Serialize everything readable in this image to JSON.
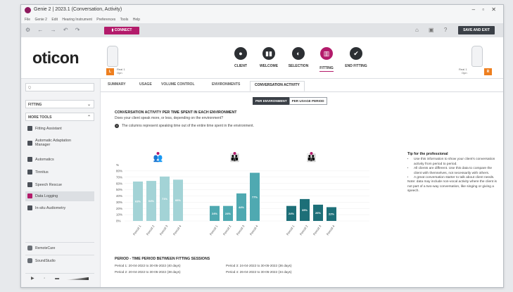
{
  "window": {
    "title": "Genie 2 | 2023.1 (Conversation, Activity)",
    "controls": "– ▫ ✕"
  },
  "menu": [
    "File",
    "Genie 2",
    "Edit",
    "Hearing Instrument",
    "Preferences",
    "Tools",
    "Help"
  ],
  "toolbar": {
    "connect_label": "CONNECT",
    "save_exit_label": "SAVE AND EXIT"
  },
  "header": {
    "logo": "oticon",
    "left_ear_badge": "L",
    "left_ear_label_1": "Real 1",
    "left_ear_label_2": "Opn",
    "right_ear_badge": "R",
    "right_ear_label_1": "Real 1",
    "right_ear_label_2": "Opn",
    "steps": [
      {
        "label": "CLIENT",
        "icon": "person-icon",
        "glyph": "●"
      },
      {
        "label": "WELCOME",
        "icon": "hearing-aids-icon",
        "glyph": "▮▮"
      },
      {
        "label": "SELECTION",
        "icon": "selection-icon",
        "glyph": "◐"
      },
      {
        "label": "FITTING",
        "icon": "fitting-icon",
        "glyph": "▥"
      },
      {
        "label": "END FITTING",
        "icon": "check-icon",
        "glyph": "✔"
      }
    ]
  },
  "sidebar": {
    "search_placeholder": "Q",
    "section_dropdown": "FITTING",
    "more_tools_dropdown": "MORE TOOLS",
    "items": [
      {
        "label": "Fitting Assistant"
      },
      {
        "label": "Automatic Adaptation"
      },
      {
        "label": "Manager"
      },
      {
        "label": "Automatics"
      },
      {
        "label": "Tinnitus"
      },
      {
        "label": "Speech Rescue"
      },
      {
        "label": "Data Logging"
      },
      {
        "label": "In-situ Audiometry"
      }
    ],
    "bottom": [
      {
        "label": "RemoteCare"
      },
      {
        "label": "SoundStudio"
      }
    ]
  },
  "tabs": [
    "SUMMARY",
    "USAGE",
    "VOLUME CONTROL",
    "ENVIRONMENTS",
    "CONVERSATION ACTIVITY"
  ],
  "toggle": {
    "per_environment": "PER ENVIRONMENT",
    "per_usage_period": "PER USAGE PERIOD"
  },
  "main": {
    "heading": "CONVERSATION ACTIVITY PER TIME SPENT IN EACH ENVIRONMENT",
    "subheading": "Does your client speak more, or less, depending on the environment?",
    "info": "The columns represent speaking time out of the entire time spent in the environment.",
    "info_icon": "i"
  },
  "chart_data": {
    "type": "bar",
    "ylabel": "%",
    "ylim": [
      0,
      90
    ],
    "yticks": [
      "80%",
      "70%",
      "60%",
      "50%",
      "40%",
      "30%",
      "20%",
      "10%",
      "0%"
    ],
    "groups": [
      {
        "name": "quiet",
        "color": "#a3d3d6",
        "categories": [
          "Period 1",
          "Period 2",
          "Period 3",
          "Period 4"
        ],
        "values": [
          63,
          64,
          71,
          66
        ],
        "value_labels": [
          "63%",
          "64%",
          "71%",
          "66%"
        ]
      },
      {
        "name": "moderate",
        "color": "#4fa9b1",
        "categories": [
          "Period 1",
          "Period 2",
          "Period 3",
          "Period 4"
        ],
        "values": [
          24,
          24,
          44,
          77
        ],
        "value_labels": [
          "24%",
          "24%",
          "44%",
          "77%"
        ]
      },
      {
        "name": "noisy",
        "color": "#1d6f78",
        "categories": [
          "Period 1",
          "Period 2",
          "Period 3",
          "Period 4"
        ],
        "values": [
          24,
          35,
          26,
          22
        ],
        "value_labels": [
          "24%",
          "35%",
          "26%",
          "22%"
        ]
      }
    ]
  },
  "tip": {
    "title": "Tip for the professional",
    "bullets": [
      "Use this information to show your client's conversation activity from period to period.",
      "All clients are different. Use this data to compare the client with themselves, not necessarily with others.",
      "A great conversation starter to talk about client needs."
    ],
    "note": "Note: data may include non-vocal activity where the client is not part of a two-way conversation, like singing or giving a speech."
  },
  "periods": {
    "heading": "PERIOD - TIME PERIOD BETWEEN FITTING SESSIONS",
    "items": [
      "Period 1: 20-04-2022 to 30-05-2022 (40 days)",
      "Period 2: 20-04-2022 to 30-05-2022 (38 days)",
      "Period 3: 24-04-2022 to 30-05-2022 (36 days)",
      "Period 4: 26-04-2022 to 30-05-2022 (34 days)"
    ]
  }
}
